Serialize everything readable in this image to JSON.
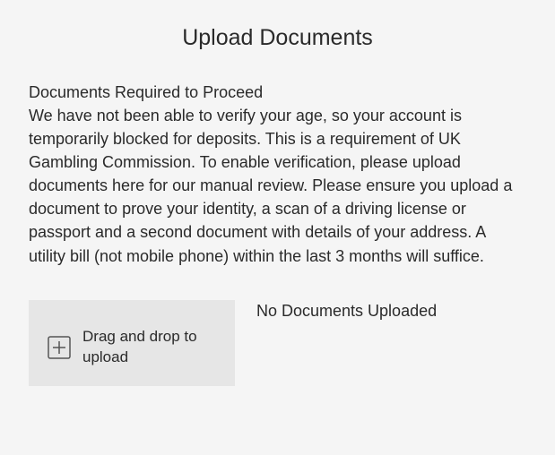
{
  "header": {
    "title": "Upload Documents"
  },
  "content": {
    "subtitle": "Documents Required to Proceed",
    "description": "We have not been able to verify your age, so your account is temporarily blocked for deposits. This is a requirement of UK Gambling Commission. To enable verification, please upload documents here for our manual review. Please ensure you upload a document to prove your identity, a scan of a driving license or passport and a second document with details of your address. A utility bill (not mobile phone) within the last 3 months will suffice."
  },
  "upload": {
    "dropzone_label": "Drag and drop to upload",
    "status": "No Documents Uploaded"
  }
}
